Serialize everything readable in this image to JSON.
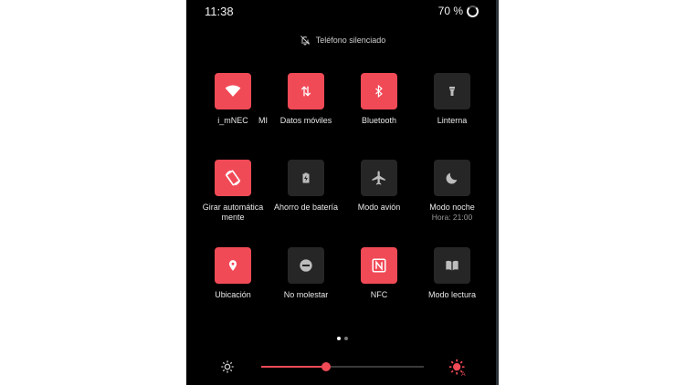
{
  "status_bar": {
    "time": "11:38",
    "battery": "70 %"
  },
  "notice": {
    "text": "Teléfono silenciado"
  },
  "tiles": [
    {
      "label": "i_mNEC",
      "label2": "MI",
      "icon": "wifi-icon",
      "active": true
    },
    {
      "label": "Datos móviles",
      "icon": "mobile-data-icon",
      "active": true
    },
    {
      "label": "Bluetooth",
      "icon": "bluetooth-icon",
      "active": true
    },
    {
      "label": "Linterna",
      "icon": "flashlight-icon",
      "active": false
    },
    {
      "label": "Girar automática",
      "label2": "mente",
      "icon": "auto-rotate-icon",
      "active": true
    },
    {
      "label": "Ahorro de batería",
      "icon": "battery-saver-icon",
      "active": false
    },
    {
      "label": "Modo avión",
      "icon": "airplane-icon",
      "active": false
    },
    {
      "label": "Modo noche",
      "sub": "Hora: 21:00",
      "icon": "moon-icon",
      "active": false
    },
    {
      "label": "Ubicación",
      "icon": "location-icon",
      "active": true
    },
    {
      "label": "No molestar",
      "icon": "do-not-disturb-icon",
      "active": false
    },
    {
      "label": "NFC",
      "icon": "nfc-icon",
      "active": true
    },
    {
      "label": "Modo lectura",
      "icon": "reading-mode-icon",
      "active": false
    }
  ],
  "pager": {
    "page": 1,
    "pages": 2
  },
  "brightness": {
    "level": 0.4
  },
  "colors": {
    "accent": "#f14a57",
    "tile_off": "#262626",
    "background": "#000000"
  }
}
